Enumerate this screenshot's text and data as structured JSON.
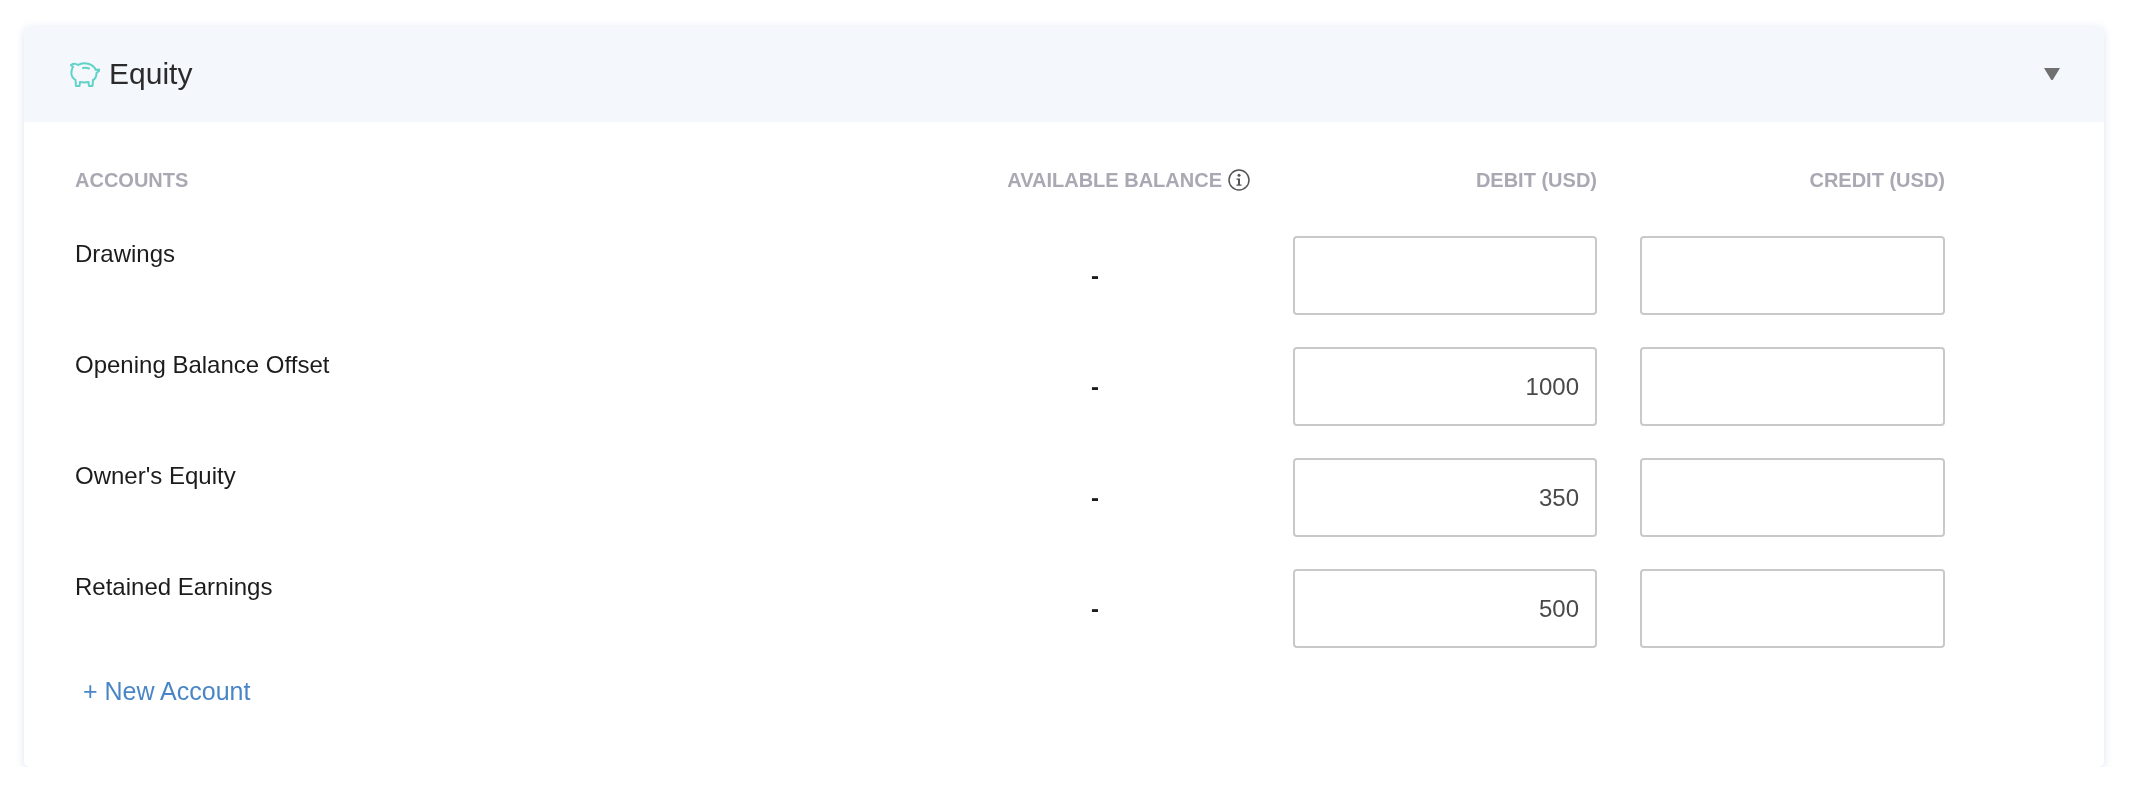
{
  "section": {
    "title": "Equity",
    "expanded": true
  },
  "columns": [
    {
      "label": "ACCOUNTS",
      "info_icon": false
    },
    {
      "label": "AVAILABLE BALANCE",
      "info_icon": true
    },
    {
      "label": "DEBIT (USD)",
      "info_icon": false
    },
    {
      "label": "CREDIT (USD)",
      "info_icon": false
    }
  ],
  "rows": [
    {
      "account": "Drawings",
      "available_balance": "-"
    },
    {
      "account": "Opening Balance Offset",
      "available_balance": "-",
      "debit": "1000"
    },
    {
      "account": "Owner's Equity",
      "available_balance": "-",
      "debit": "350"
    },
    {
      "account": "Retained Earnings",
      "available_balance": "-",
      "debit": "500"
    }
  ],
  "add_link": "+ New Account"
}
